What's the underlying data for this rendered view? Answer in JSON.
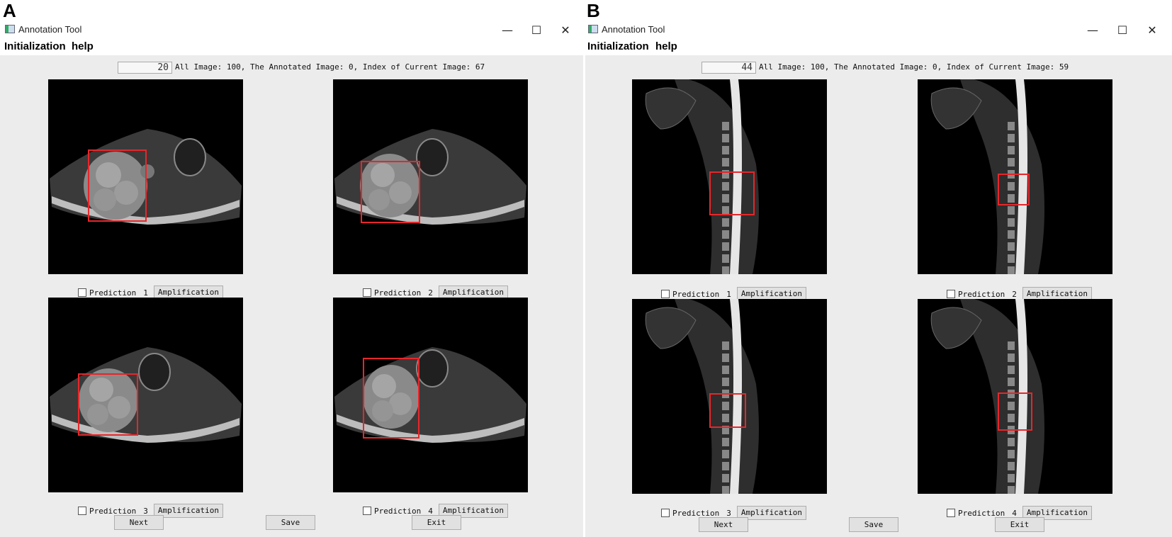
{
  "panels": [
    {
      "letter": "A",
      "window_title": "Annotation Tool",
      "menu": [
        "Initialization",
        "help"
      ],
      "counter_value": "20",
      "info_text": "All Image: 100, The Annotated Image: 0, Index of Current Image: 67",
      "predictions": [
        {
          "label": "Prediction",
          "number": "1",
          "button": "Amplification"
        },
        {
          "label": "Prediction",
          "number": "2",
          "button": "Amplification"
        },
        {
          "label": "Prediction",
          "number": "3",
          "button": "Amplification"
        },
        {
          "label": "Prediction",
          "number": "4",
          "button": "Amplification"
        }
      ],
      "buttons": {
        "next": "Next",
        "save": "Save",
        "exit": "Exit"
      }
    },
    {
      "letter": "B",
      "window_title": "Annotation Tool",
      "menu": [
        "Initialization",
        "help"
      ],
      "counter_value": "44",
      "info_text": "All Image: 100, The Annotated Image: 0, Index of Current Image: 59",
      "predictions": [
        {
          "label": "Prediction",
          "number": "1",
          "button": "Amplification"
        },
        {
          "label": "Prediction",
          "number": "2",
          "button": "Amplification"
        },
        {
          "label": "Prediction",
          "number": "3",
          "button": "Amplification"
        },
        {
          "label": "Prediction",
          "number": "4",
          "button": "Amplification"
        }
      ],
      "buttons": {
        "next": "Next",
        "save": "Save",
        "exit": "Exit"
      }
    }
  ],
  "icons": {
    "minimize": "minimize-icon",
    "maximize": "maximize-icon",
    "close": "close-icon",
    "app": "app-icon"
  },
  "colors": {
    "annotation_box": "#e8262a",
    "content_bg": "#ececec",
    "button_bg": "#e1e1e1"
  }
}
